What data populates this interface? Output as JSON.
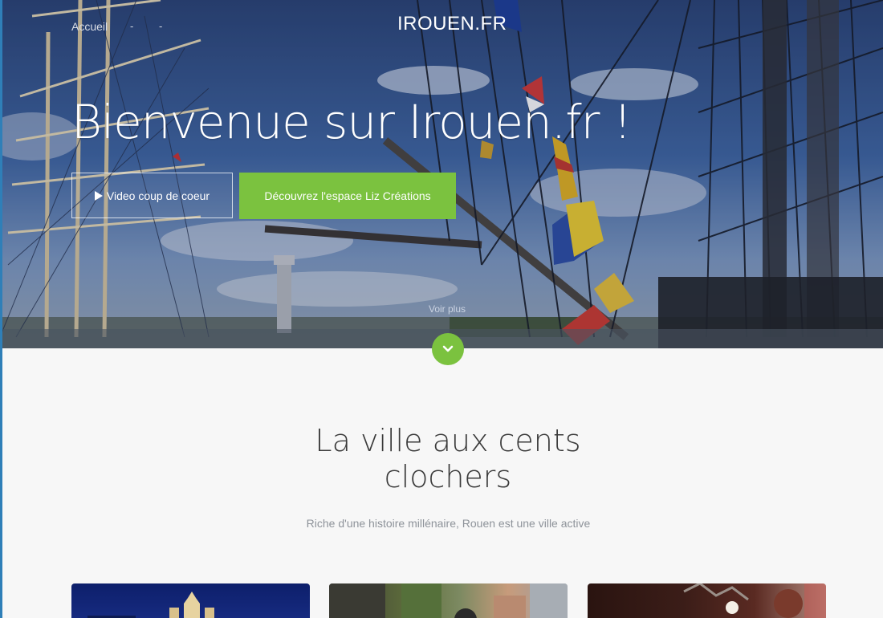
{
  "nav": {
    "home_label": "Accueil",
    "separator_1": "-",
    "separator_2": "-"
  },
  "brand": "IROUEN.FR",
  "hero": {
    "title": "Bienvenue sur Irouen.fr !",
    "video_button_label": "Video coup de coeur",
    "cta_button_label": "Découvrez l'espace Liz Créations",
    "see_more_label": "Voir plus",
    "scroll_icon": "chevron-down-icon"
  },
  "section": {
    "title": "La ville aux cents clochers",
    "subtitle": "Riche d'une histoire millénaire, Rouen est une ville active"
  },
  "colors": {
    "accent_green": "#7bc23f",
    "page_background": "#f7f7f7",
    "title_text": "#3a3a3a",
    "subtitle_text": "#8e939a",
    "left_edge": "#2f7fb8"
  }
}
